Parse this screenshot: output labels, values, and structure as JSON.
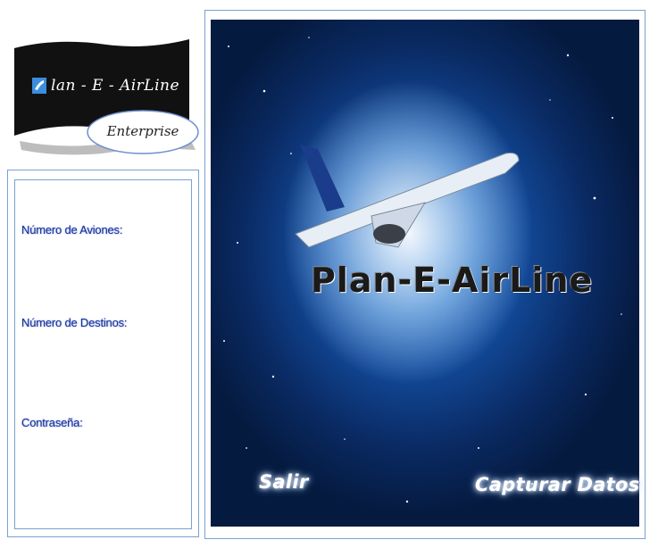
{
  "logo": {
    "title": "lan - E - AirLine",
    "subtitle": "Enterprise",
    "icon": "airplane-badge-icon"
  },
  "form": {
    "aviones_label": "Número de Aviones:",
    "destinos_label": "Número de Destinos:",
    "contrasena_label": "Contraseña:"
  },
  "hero": {
    "brand": "Plan-E-AirLine",
    "exit_label": "Salir",
    "capture_label": "Capturar Datos"
  },
  "colors": {
    "border": "#7aa0d0",
    "label_text": "#1a2f86",
    "space_dark": "#051a3f",
    "space_mid": "#124a9a"
  }
}
